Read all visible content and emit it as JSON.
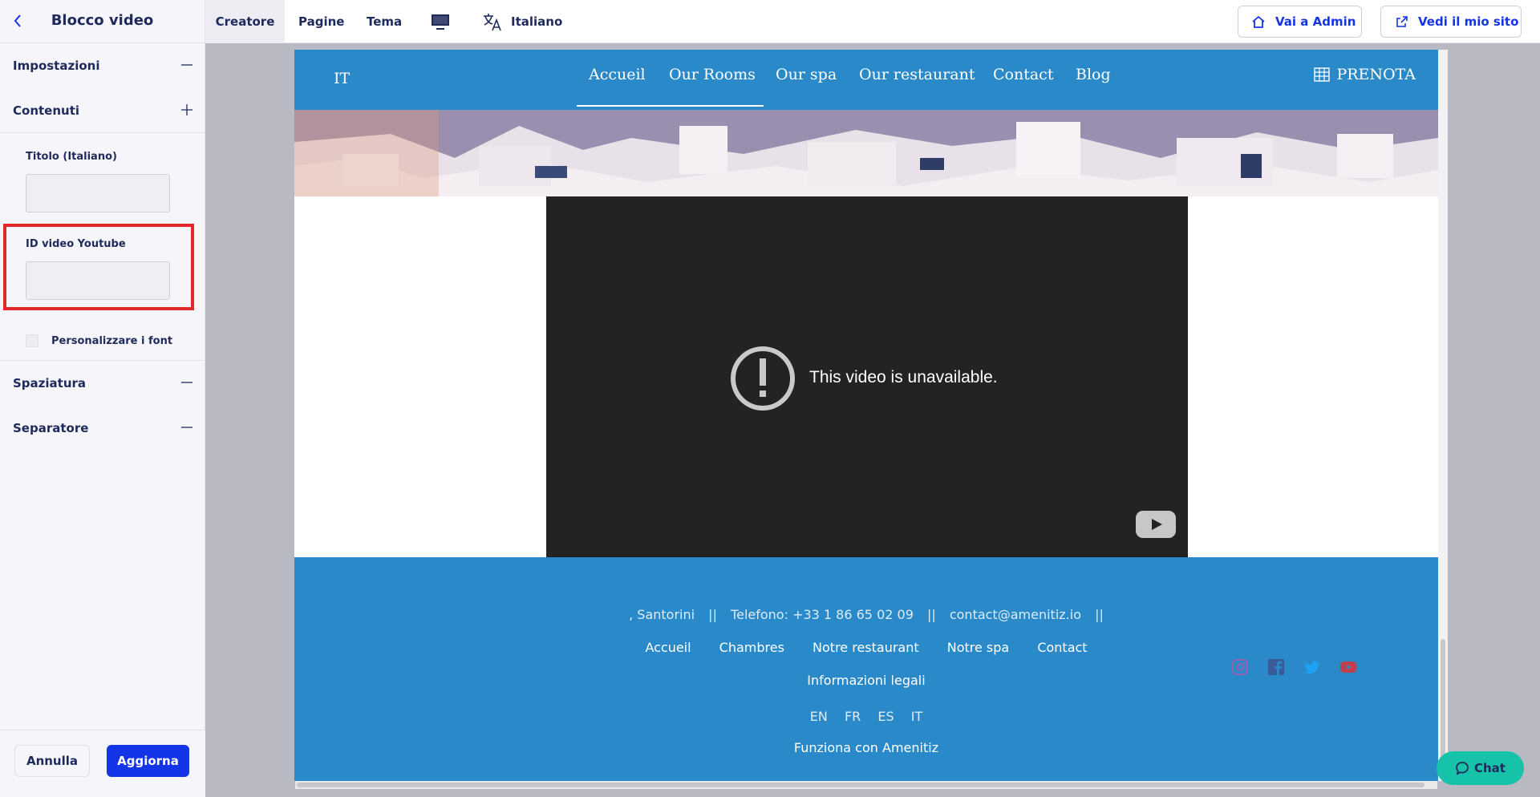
{
  "sidebar": {
    "title": "Blocco video",
    "sections": {
      "settings": "Impostazioni",
      "content": "Contenuti",
      "spacing": "Spaziatura",
      "separator": "Separatore"
    },
    "fields": {
      "title_label": "Titolo (Italiano)",
      "title_value": "",
      "youtube_label": "ID video Youtube",
      "youtube_value": "",
      "custom_font_label": "Personalizzare i font"
    },
    "footer": {
      "cancel": "Annulla",
      "update": "Aggiorna"
    }
  },
  "topbar": {
    "tabs": [
      "Creatore",
      "Pagine",
      "Tema"
    ],
    "language": "Italiano",
    "admin_button": "Vai a Admin",
    "site_button": "Vedi il mio sito"
  },
  "site": {
    "lang": "IT",
    "nav": [
      "Accueil",
      "Our Rooms",
      "Our spa",
      "Our restaurant",
      "Contact",
      "Blog"
    ],
    "book": "PRENOTA",
    "video_message": "This video is unavailable.",
    "footer": {
      "address": ", Santorini",
      "phone": "Telefono: +33 1 86 65 02 09",
      "email": "contact@amenitiz.io",
      "sep": "||",
      "links": [
        "Accueil",
        "Chambres",
        "Notre restaurant",
        "Notre spa",
        "Contact"
      ],
      "legal": "Informazioni legali",
      "langs": [
        "EN",
        "FR",
        "ES",
        "IT"
      ],
      "powered": "Funziona con Amenitiz"
    }
  },
  "chat": "Chat",
  "colors": {
    "brand_blue": "#2a8ac9",
    "primary_button": "#1434e8",
    "highlight": "#e3262a",
    "chat": "#17c3a8"
  }
}
